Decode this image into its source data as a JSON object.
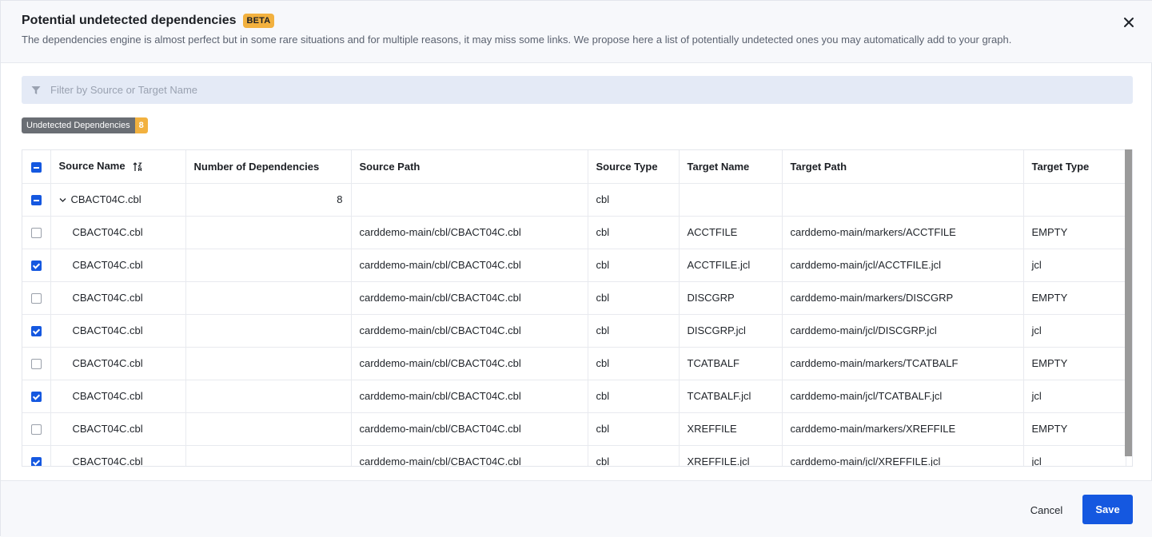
{
  "header": {
    "title": "Potential undetected dependencies",
    "badge": "BETA",
    "subtitle": "The dependencies engine is almost perfect but in some rare situations and for multiple reasons, it may miss some links. We propose here a list of potentially undetected ones you may automatically add to your graph."
  },
  "filter": {
    "placeholder": "Filter by Source or Target Name",
    "value": ""
  },
  "tag": {
    "label": "Undetected Dependencies",
    "count": "8"
  },
  "table": {
    "columns": [
      "Source Name",
      "Number of Dependencies",
      "Source Path",
      "Source Type",
      "Target Name",
      "Target Path",
      "Target Type"
    ],
    "group": {
      "checkbox": "partial",
      "source_name": "CBACT04C.cbl",
      "count": "8",
      "source_path": "",
      "source_type": "cbl",
      "target_name": "",
      "target_path": "",
      "target_type": ""
    },
    "rows": [
      {
        "checked": false,
        "source_name": "CBACT04C.cbl",
        "source_path": "carddemo-main/cbl/CBACT04C.cbl",
        "source_type": "cbl",
        "target_name": "ACCTFILE",
        "target_path": "carddemo-main/markers/ACCTFILE",
        "target_type": "EMPTY"
      },
      {
        "checked": true,
        "source_name": "CBACT04C.cbl",
        "source_path": "carddemo-main/cbl/CBACT04C.cbl",
        "source_type": "cbl",
        "target_name": "ACCTFILE.jcl",
        "target_path": "carddemo-main/jcl/ACCTFILE.jcl",
        "target_type": "jcl"
      },
      {
        "checked": false,
        "source_name": "CBACT04C.cbl",
        "source_path": "carddemo-main/cbl/CBACT04C.cbl",
        "source_type": "cbl",
        "target_name": "DISCGRP",
        "target_path": "carddemo-main/markers/DISCGRP",
        "target_type": "EMPTY"
      },
      {
        "checked": true,
        "source_name": "CBACT04C.cbl",
        "source_path": "carddemo-main/cbl/CBACT04C.cbl",
        "source_type": "cbl",
        "target_name": "DISCGRP.jcl",
        "target_path": "carddemo-main/jcl/DISCGRP.jcl",
        "target_type": "jcl"
      },
      {
        "checked": false,
        "source_name": "CBACT04C.cbl",
        "source_path": "carddemo-main/cbl/CBACT04C.cbl",
        "source_type": "cbl",
        "target_name": "TCATBALF",
        "target_path": "carddemo-main/markers/TCATBALF",
        "target_type": "EMPTY"
      },
      {
        "checked": true,
        "source_name": "CBACT04C.cbl",
        "source_path": "carddemo-main/cbl/CBACT04C.cbl",
        "source_type": "cbl",
        "target_name": "TCATBALF.jcl",
        "target_path": "carddemo-main/jcl/TCATBALF.jcl",
        "target_type": "jcl"
      },
      {
        "checked": false,
        "source_name": "CBACT04C.cbl",
        "source_path": "carddemo-main/cbl/CBACT04C.cbl",
        "source_type": "cbl",
        "target_name": "XREFFILE",
        "target_path": "carddemo-main/markers/XREFFILE",
        "target_type": "EMPTY"
      },
      {
        "checked": true,
        "source_name": "CBACT04C.cbl",
        "source_path": "carddemo-main/cbl/CBACT04C.cbl",
        "source_type": "cbl",
        "target_name": "XREFFILE.jcl",
        "target_path": "carddemo-main/jcl/XREFFILE.jcl",
        "target_type": "jcl"
      }
    ]
  },
  "footer": {
    "cancel_label": "Cancel",
    "save_label": "Save"
  },
  "icons": {
    "close": "close-icon",
    "filter": "filter-icon",
    "sort": "sort-icon",
    "chevron": "chevron-down-icon"
  },
  "colors": {
    "accent": "#1558e0",
    "badge": "#f2b13f",
    "tag_label": "#6a6e74",
    "filter_bg": "#e4eaf6"
  }
}
